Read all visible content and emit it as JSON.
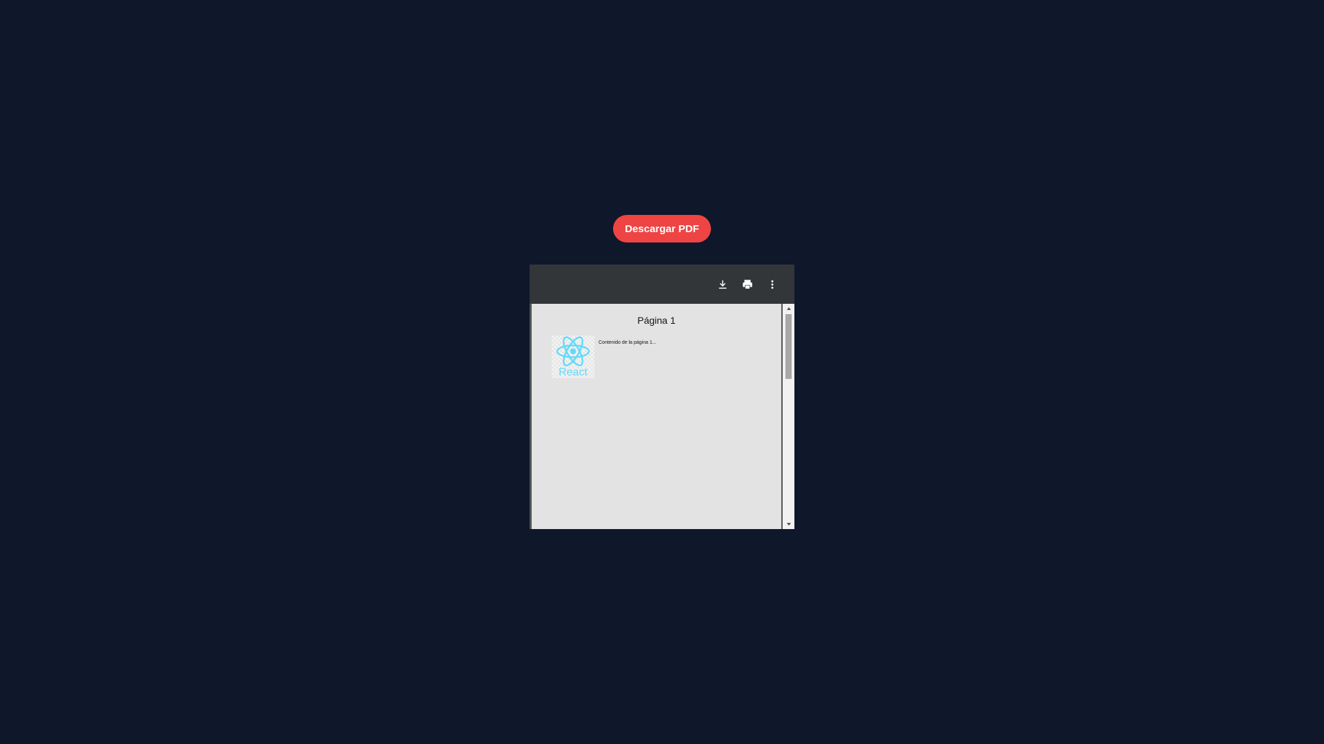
{
  "app": {
    "download_button_label": "Descargar PDF"
  },
  "viewer": {
    "toolbar": {
      "icons": [
        "download-icon",
        "print-icon",
        "more-vert-icon"
      ]
    },
    "page": {
      "title": "Página 1",
      "content": "Contenido de la página 1...",
      "logo_text": "React"
    }
  },
  "colors": {
    "background": "#0f172a",
    "button": "#ef4444",
    "toolbar": "#323639",
    "page": "#e3e3e3",
    "react": "#61dafb"
  }
}
